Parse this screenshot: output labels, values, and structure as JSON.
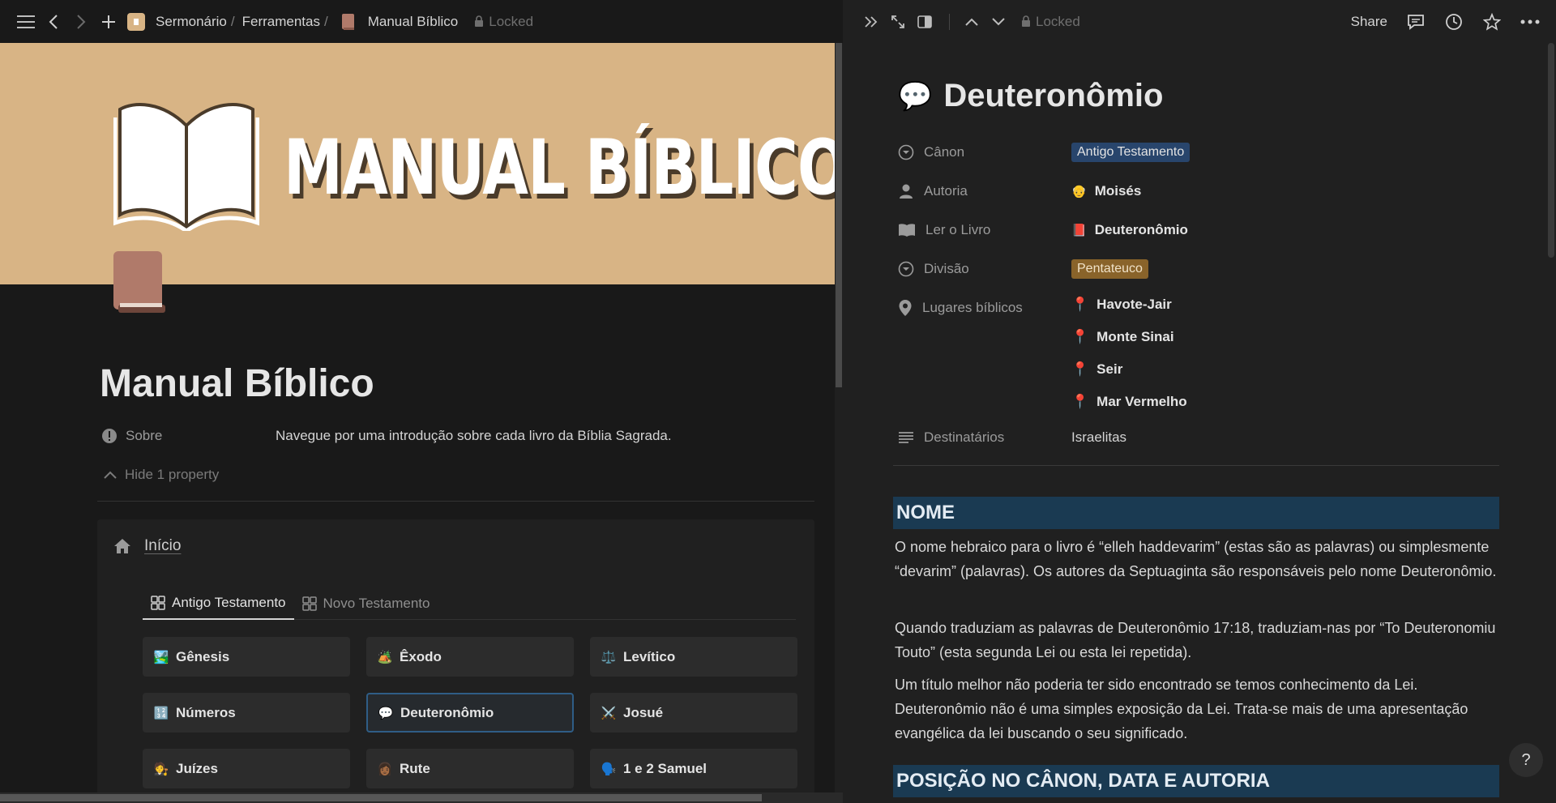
{
  "left": {
    "breadcrumb": {
      "root": "Sermonário",
      "sep1": "/",
      "folder": "Ferramentas",
      "sep2": "/",
      "page": "Manual Bíblico"
    },
    "locked_label": "Locked",
    "cover_title": "MANUAL BÍBLICO",
    "title": "Manual Bíblico",
    "property": {
      "label": "Sobre",
      "value": "Navegue por uma introdução sobre cada livro da Bíblia Sagrada."
    },
    "hide_property_label": "Hide 1 property",
    "section": {
      "title": "Início",
      "tabs": [
        {
          "label": "Antigo Testamento",
          "active": true
        },
        {
          "label": "Novo Testamento",
          "active": false
        }
      ],
      "cards": [
        {
          "emoji": "🏞️",
          "label": "Gênesis"
        },
        {
          "emoji": "🏕️",
          "label": "Êxodo"
        },
        {
          "emoji": "⚖️",
          "label": "Levítico"
        },
        {
          "emoji": "🔢",
          "label": "Números"
        },
        {
          "emoji": "💬",
          "label": "Deuteronômio",
          "selected": true
        },
        {
          "emoji": "⚔️",
          "label": "Josué"
        },
        {
          "emoji": "🧑‍⚖️",
          "label": "Juízes"
        },
        {
          "emoji": "👩🏾",
          "label": "Rute"
        },
        {
          "emoji": "🗣️",
          "label": "1 e 2 Samuel"
        }
      ]
    }
  },
  "right": {
    "locked_label": "Locked",
    "share_label": "Share",
    "title_emoji": "💬",
    "title": "Deuteronômio",
    "properties": {
      "canon": {
        "label": "Cânon",
        "value": "Antigo Testamento",
        "color": "#28456c"
      },
      "autoria": {
        "label": "Autoria",
        "value": "Moisés",
        "emoji": "👴"
      },
      "ler": {
        "label": "Ler o Livro",
        "value": "Deuteronômio",
        "emoji": "📕"
      },
      "divisao": {
        "label": "Divisão",
        "value": "Pentateuco",
        "color": "#89632a"
      },
      "lugares": {
        "label": "Lugares bíblicos",
        "values": [
          "Havote-Jair",
          "Monte Sinai",
          "Seir",
          "Mar Vermelho"
        ]
      },
      "destinatarios": {
        "label": "Destinatários",
        "value": "Israelitas"
      }
    },
    "sections": [
      {
        "heading": "NOME",
        "paragraphs": [
          "O nome hebraico para o livro é “elleh haddevarim” (estas são as palavras) ou simplesmente “devarim” (palavras). Os autores da Septuaginta são responsáveis pelo nome Deuteronômio.",
          "Quando traduziam as palavras de Deuteronômio 17:18, traduziam-nas por “To Deuteronomiu Touto” (esta segunda Lei ou esta lei repetida).",
          "Um título melhor não poderia ter sido encontrado se temos conhecimento da Lei. Deuteronômio não é uma simples exposição da Lei. Trata-se mais de uma apresentação evangélica da lei buscando o seu significado."
        ]
      },
      {
        "heading": "POSIÇÃO NO CÂNON, DATA E AUTORIA"
      }
    ],
    "help_label": "?"
  },
  "colors": {
    "background": "#191919",
    "panel": "#202020",
    "cover": "#d8b485",
    "heading_bg": "#1a3a52"
  }
}
